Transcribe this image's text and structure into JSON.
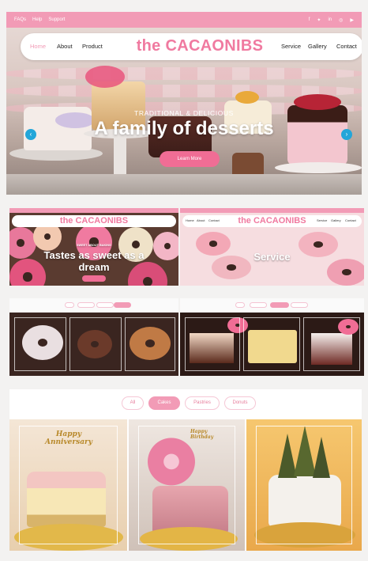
{
  "hero": {
    "top_links": [
      "FAQs",
      "Help",
      "Support"
    ],
    "social_icons": [
      "facebook-icon",
      "twitter-icon",
      "linkedin-icon",
      "instagram-icon",
      "youtube-icon"
    ],
    "nav_left": [
      "Home",
      "About",
      "Product"
    ],
    "brand": "the CACAONIBS",
    "nav_right": [
      "Service",
      "Gallery",
      "Contact"
    ],
    "subtitle": "TRADITIONAL & DELICIOUS",
    "title": "A family  of desserts",
    "button": "Learn More",
    "prev_arrow": "‹",
    "next_arrow": "›"
  },
  "thumb1": {
    "brand": "the CACAONIBS",
    "subtitle": "SWEET ABOUT BAKING",
    "title_line1": "Tastes as sweet as a",
    "title_line2": "dream"
  },
  "thumb2": {
    "brand": "the CACAONIBS",
    "nav_left": [
      "Home",
      "About",
      "Contact"
    ],
    "nav_right": [
      "Service",
      "Gallery",
      "Contact"
    ],
    "title": "Service"
  },
  "gallery": {
    "tabs": [
      "All",
      "Cakes",
      "Pastries",
      "Donuts"
    ],
    "active_tab": "Cakes",
    "cake_toppers": [
      "Happy Anniversary",
      "Happy Birthday"
    ]
  },
  "colors": {
    "accent_pink": "#f29bb6",
    "brand_pink": "#f07aa0",
    "button_pink": "#f06d95",
    "arrow_blue": "#23a6d9"
  }
}
